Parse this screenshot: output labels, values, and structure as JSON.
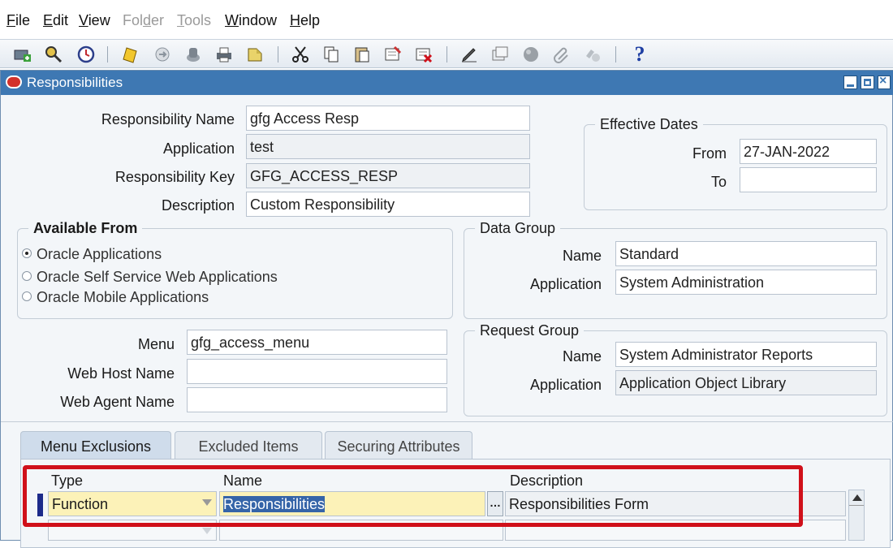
{
  "menu": {
    "items": [
      {
        "label": "File",
        "enabled": true
      },
      {
        "label": "Edit",
        "enabled": true
      },
      {
        "label": "View",
        "enabled": true
      },
      {
        "label": "Folder",
        "enabled": false
      },
      {
        "label": "Tools",
        "enabled": false
      },
      {
        "label": "Window",
        "enabled": true
      },
      {
        "label": "Help",
        "enabled": true
      }
    ]
  },
  "toolbar": {
    "icons": [
      "new-icon",
      "find-icon",
      "navigator-icon",
      "save-icon",
      "next-step-icon",
      "switch-responsibility-icon",
      "print-icon",
      "close-form-icon",
      "cut-icon",
      "copy-icon",
      "paste-icon",
      "new-record-icon",
      "delete-record-icon",
      "edit-field-icon",
      "zoom-icon",
      "translations-icon",
      "attachments-icon",
      "folder-tools-icon",
      "help-icon"
    ],
    "help_glyph": "?"
  },
  "window": {
    "title": "Responsibilities",
    "title_color": "#3e78b3"
  },
  "form": {
    "responsibility_name_label": "Responsibility Name",
    "responsibility_name": "gfg Access Resp",
    "application_label": "Application",
    "application": "test",
    "responsibility_key_label": "Responsibility Key",
    "responsibility_key": "GFG_ACCESS_RESP",
    "description_label": "Description",
    "description": "Custom Responsibility",
    "menu_label": "Menu",
    "menu": "gfg_access_menu",
    "web_host_label": "Web Host Name",
    "web_host": "",
    "web_agent_label": "Web Agent Name",
    "web_agent": ""
  },
  "effective_dates": {
    "title": "Effective Dates",
    "from_label": "From",
    "from": "27-JAN-2022",
    "to_label": "To",
    "to": ""
  },
  "available_from": {
    "title": "Available From",
    "options": [
      {
        "label": "Oracle Applications",
        "selected": true
      },
      {
        "label": "Oracle Self Service Web Applications",
        "selected": false
      },
      {
        "label": "Oracle Mobile Applications",
        "selected": false
      }
    ]
  },
  "data_group": {
    "title": "Data Group",
    "name_label": "Name",
    "name": "Standard",
    "application_label": "Application",
    "application": "System Administration"
  },
  "request_group": {
    "title": "Request Group",
    "name_label": "Name",
    "name": "System Administrator Reports",
    "application_label": "Application",
    "application": "Application Object Library"
  },
  "tabs": [
    {
      "label": "Menu Exclusions",
      "active": true
    },
    {
      "label": "Excluded Items",
      "active": false
    },
    {
      "label": "Securing Attributes",
      "active": false
    }
  ],
  "exclusions": {
    "headers": {
      "type": "Type",
      "name": "Name",
      "description": "Description"
    },
    "rows": [
      {
        "type": "Function",
        "name": "Responsibilities",
        "description": "Responsibilities Form"
      }
    ],
    "lov_glyph": "…"
  },
  "colors": {
    "highlight_box": "#d0101a",
    "current_field": "#fcf2b8",
    "selection": "#3564a8"
  }
}
